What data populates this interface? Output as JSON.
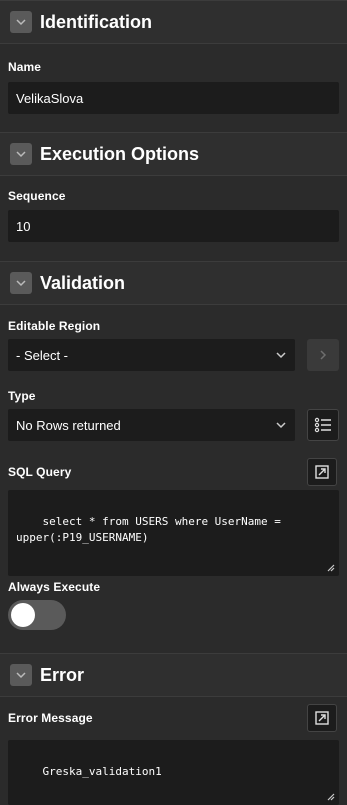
{
  "identification": {
    "title": "Identification",
    "name_label": "Name",
    "name_value": "VelikaSlova"
  },
  "execution": {
    "title": "Execution Options",
    "sequence_label": "Sequence",
    "sequence_value": "10"
  },
  "validation": {
    "title": "Validation",
    "editable_region_label": "Editable Region",
    "editable_region_value": "- Select -",
    "type_label": "Type",
    "type_value": "No Rows returned",
    "sql_query_label": "SQL Query",
    "sql_query_value": "select * from USERS where UserName =\nupper(:P19_USERNAME)",
    "always_execute_label": "Always Execute",
    "always_execute_on": false
  },
  "error": {
    "title": "Error",
    "error_message_label": "Error Message",
    "error_message_value": "Greska_validation1"
  }
}
